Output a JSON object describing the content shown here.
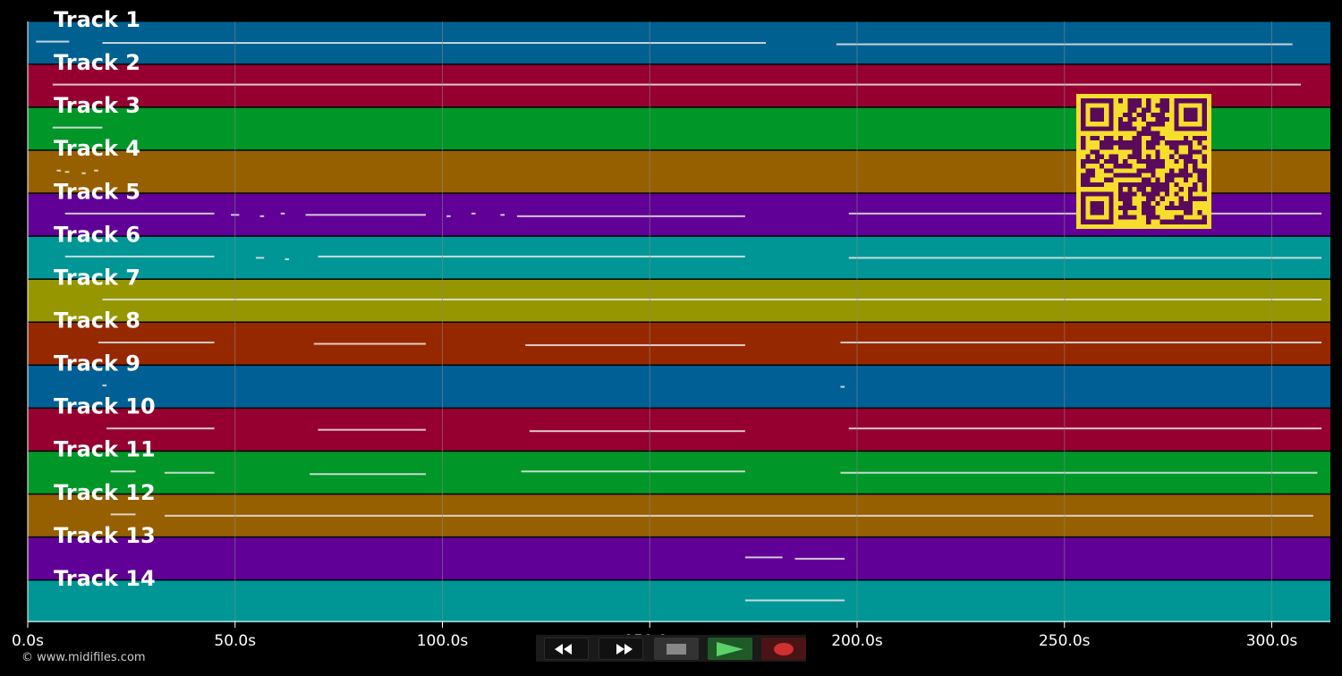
{
  "timeline": {
    "tracks": [
      {
        "label": "Track 1",
        "color": "#006090"
      },
      {
        "label": "Track 2",
        "color": "#960030"
      },
      {
        "label": "Track 3",
        "color": "#009628"
      },
      {
        "label": "Track 4",
        "color": "#966000"
      },
      {
        "label": "Track 5",
        "color": "#600096"
      },
      {
        "label": "Track 6",
        "color": "#009696"
      },
      {
        "label": "Track 7",
        "color": "#969600"
      },
      {
        "label": "Track 8",
        "color": "#962800"
      },
      {
        "label": "Track 9",
        "color": "#006096"
      },
      {
        "label": "Track 10",
        "color": "#960030"
      },
      {
        "label": "Track 11",
        "color": "#009628"
      },
      {
        "label": "Track 12",
        "color": "#966000"
      },
      {
        "label": "Track 13",
        "color": "#600096"
      },
      {
        "label": "Track 14",
        "color": "#009696"
      }
    ],
    "time_ticks": [
      "0.0s",
      "50.0s",
      "100.0s",
      "150.0s",
      "200.0s",
      "250.0s",
      "300.0s"
    ],
    "note_color": "#e8e8e8",
    "grid_color": "#888888"
  },
  "note_segments": [
    [
      [
        2,
        10
      ],
      [
        18,
        178
      ],
      [
        195,
        305
      ]
    ],
    [
      [
        6,
        307
      ]
    ],
    [
      [
        6,
        18
      ]
    ],
    [
      [
        7,
        8
      ],
      [
        9,
        10
      ],
      [
        13,
        14
      ],
      [
        16,
        17
      ]
    ],
    [
      [
        9,
        45
      ],
      [
        49,
        51
      ],
      [
        56,
        57
      ],
      [
        61,
        62
      ],
      [
        67,
        96
      ],
      [
        101,
        102
      ],
      [
        107,
        108
      ],
      [
        114,
        115
      ],
      [
        118,
        173
      ],
      [
        198,
        312
      ]
    ],
    [
      [
        9,
        45
      ],
      [
        55,
        57
      ],
      [
        62,
        63
      ],
      [
        70,
        173
      ],
      [
        198,
        312
      ]
    ],
    [
      [
        18,
        312
      ]
    ],
    [
      [
        17,
        45
      ],
      [
        69,
        96
      ],
      [
        120,
        173
      ],
      [
        196,
        312
      ]
    ],
    [
      [
        18,
        19
      ],
      [
        196,
        197
      ]
    ],
    [
      [
        19,
        45
      ],
      [
        70,
        96
      ],
      [
        121,
        173
      ],
      [
        198,
        312
      ]
    ],
    [
      [
        20,
        26
      ],
      [
        33,
        45
      ],
      [
        68,
        96
      ],
      [
        119,
        173
      ],
      [
        196,
        311
      ]
    ],
    [
      [
        20,
        26
      ],
      [
        33,
        310
      ]
    ],
    [
      [
        173,
        182
      ],
      [
        185,
        197
      ]
    ],
    [
      [
        173,
        197
      ]
    ]
  ],
  "qr_code": {
    "color": "#f7dd2c",
    "module_color": "#5a0a5a"
  },
  "footer": {
    "copyright": "© www.midifiles.com"
  },
  "transport": {
    "rewind_icon": "double-chevron-left",
    "forward_icon": "double-chevron-right",
    "stop_icon": "square",
    "play_icon": "triangle-right",
    "record_icon": "circle",
    "stop_color": "#888888",
    "play_color": "#5bd16a",
    "record_color": "#d03030"
  }
}
